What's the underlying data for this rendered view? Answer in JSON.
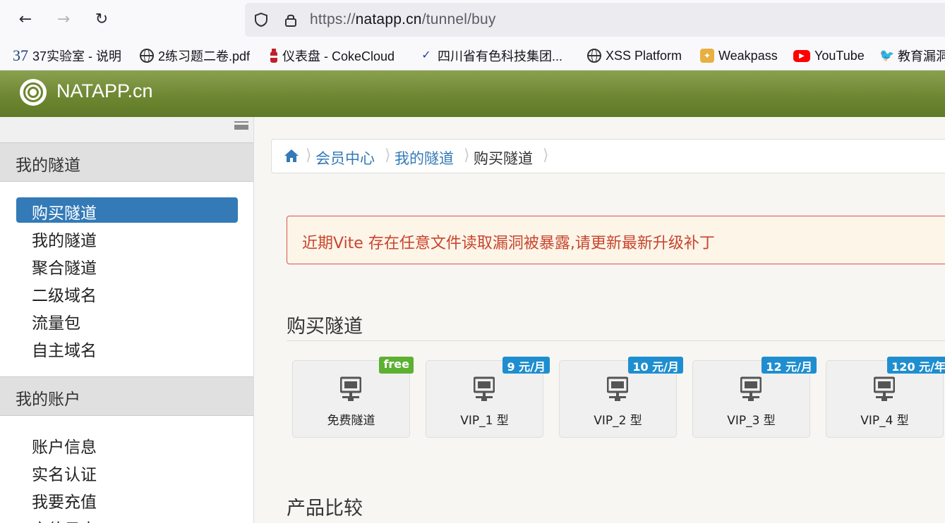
{
  "browser": {
    "url_prefix": "https://",
    "url_host": "natapp.cn",
    "url_path": "/tunnel/buy",
    "bookmarks": [
      {
        "label": "37实验室 - 说明",
        "icon": "37-logo-icon"
      },
      {
        "label": "2练习题二卷.pdf",
        "icon": "globe-icon"
      },
      {
        "label": "仪表盘 - CokeCloud",
        "icon": "coke-bottle-icon"
      },
      {
        "label": "四川省有色科技集团...",
        "icon": "flame-logo-icon"
      },
      {
        "label": "XSS Platform",
        "icon": "globe-icon"
      },
      {
        "label": "Weakpass",
        "icon": "weakpass-icon"
      },
      {
        "label": "YouTube",
        "icon": "youtube-icon"
      },
      {
        "label": "教育漏洞",
        "icon": "bird-icon"
      }
    ]
  },
  "app": {
    "brand": "NATAPP.cn"
  },
  "sidebar": {
    "section1": "我的隧道",
    "section1_items": [
      "购买隧道",
      "我的隧道",
      "聚合隧道",
      "二级域名",
      "流量包",
      "自主域名"
    ],
    "section2": "我的账户",
    "section2_items": [
      "账户信息",
      "实名认证",
      "我要充值",
      "充值日志"
    ]
  },
  "breadcrumb": {
    "items": [
      "会员中心",
      "我的隧道"
    ],
    "current": "购买隧道"
  },
  "alert": {
    "text": "近期Vite 存在任意文件读取漏洞被暴露,请更新最新升级补丁"
  },
  "main": {
    "buy_title": "购买隧道",
    "compare_title": "产品比较",
    "products": [
      {
        "name": "免费隧道",
        "price": "free",
        "free": true
      },
      {
        "name": "VIP_1 型",
        "price": "9 元/月",
        "free": false
      },
      {
        "name": "VIP_2 型",
        "price": "10 元/月",
        "free": false
      },
      {
        "name": "VIP_3 型",
        "price": "12 元/月",
        "free": false
      },
      {
        "name": "VIP_4 型",
        "price": "120 元/年",
        "free": false
      }
    ]
  },
  "colors": {
    "header_green": "#6c8530",
    "active_blue": "#337ab7",
    "badge_free": "#5cb032",
    "badge_paid": "#1f8ed0",
    "alert_text": "#c9452e"
  }
}
